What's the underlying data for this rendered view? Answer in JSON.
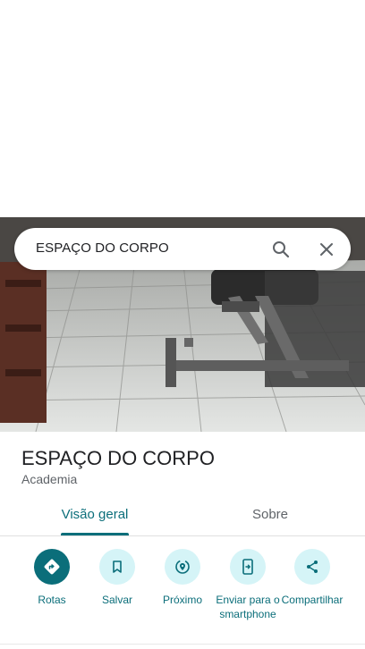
{
  "search": {
    "query": "ESPAÇO DO CORPO",
    "search_icon": "search-icon",
    "close_icon": "close-icon"
  },
  "place": {
    "name": "ESPAÇO DO CORPO",
    "category": "Academia"
  },
  "tabs": [
    {
      "label": "Visão geral",
      "selected": true
    },
    {
      "label": "Sobre",
      "selected": false
    }
  ],
  "actions": [
    {
      "label": "Rotas",
      "icon": "directions-icon"
    },
    {
      "label": "Salvar",
      "icon": "bookmark-icon"
    },
    {
      "label": "Próximo",
      "icon": "nearby-icon"
    },
    {
      "label": "Enviar para o smartphone",
      "icon": "send-to-phone-icon"
    },
    {
      "label": "Compartilhar",
      "icon": "share-icon"
    }
  ],
  "colors": {
    "accent": "#0b6e7a",
    "action_bg": "#d5f4f7",
    "text_primary": "#202124",
    "text_secondary": "#5f6368"
  }
}
